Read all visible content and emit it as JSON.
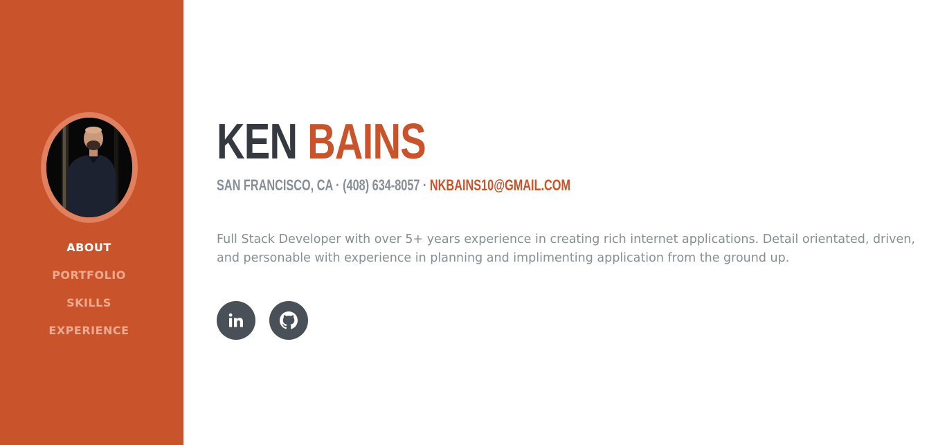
{
  "profile": {
    "first_name": "KEN",
    "last_name": "BAINS",
    "location": "SAN FRANCISCO, CA",
    "separator": " · ",
    "phone": "(408) 634-8057",
    "email": "NKBAINS10@GMAIL.COM",
    "bio": "Full Stack Developer with over 5+ years experience in creating rich internet applications. Detail orientated, driven, and personable with experience in planning and implimenting application from the ground up."
  },
  "nav": {
    "items": [
      {
        "label": "ABOUT",
        "active": true
      },
      {
        "label": "PORTFOLIO",
        "active": false
      },
      {
        "label": "SKILLS",
        "active": false
      },
      {
        "label": "EXPERIENCE",
        "active": false
      }
    ]
  },
  "social": [
    {
      "icon": "linkedin-icon"
    },
    {
      "icon": "github-icon"
    }
  ],
  "colors": {
    "primary": "#c9532a",
    "dark": "#343a40",
    "muted": "#868e96",
    "icon_bg": "#495057"
  }
}
